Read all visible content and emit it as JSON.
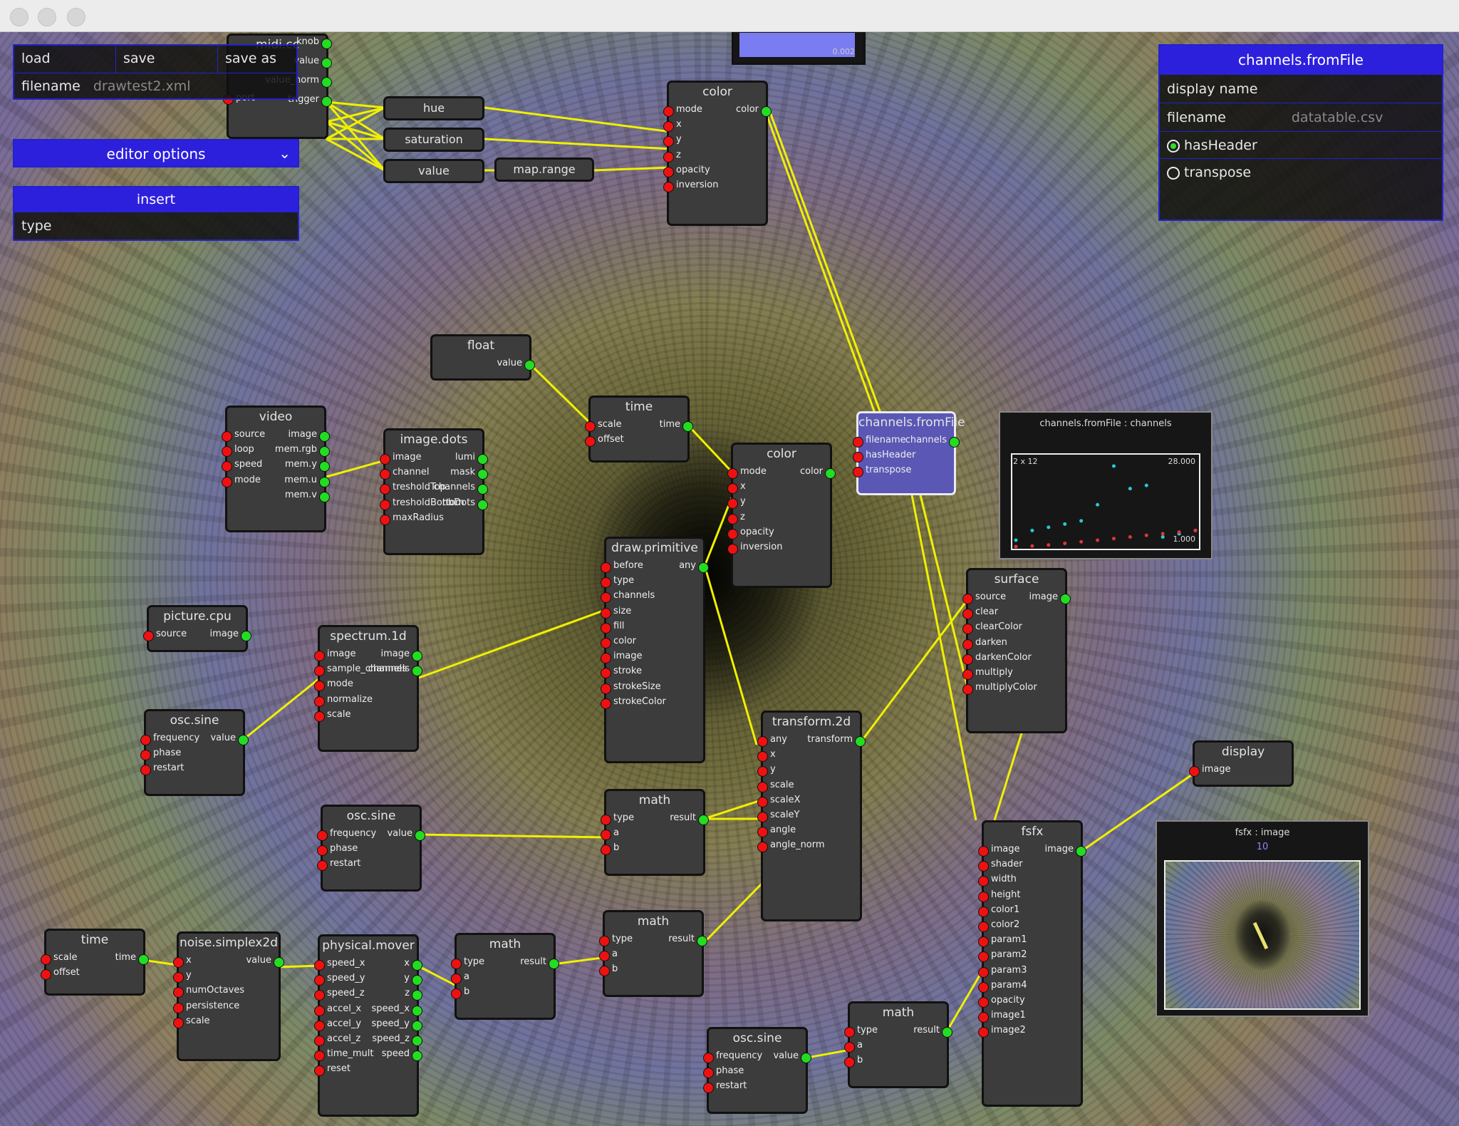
{
  "toolbar": {
    "load": "load",
    "save": "save",
    "save_as": "save as",
    "filename_label": "filename",
    "filename_value": "drawtest2.xml"
  },
  "editor_options": {
    "label": "editor options"
  },
  "insert": {
    "title": "insert",
    "type_label": "type"
  },
  "inspector": {
    "title": "channels.fromFile",
    "display_name_label": "display name",
    "filename_label": "filename",
    "filename_value": "datatable.csv",
    "has_header_label": "hasHeader",
    "has_header_checked": true,
    "transpose_label": "transpose",
    "transpose_checked": false
  },
  "top_preview": {
    "value": "0.002"
  },
  "midi": {
    "title": "midi.cc",
    "port_label": "port",
    "outputs": [
      "knob",
      "value",
      "value_norm",
      "trigger"
    ]
  },
  "hue": {
    "title": "hue"
  },
  "saturation": {
    "title": "saturation"
  },
  "value_node": {
    "title": "value"
  },
  "map_range": {
    "title": "map.range"
  },
  "color_top": {
    "title": "color",
    "inputs": [
      "mode",
      "x",
      "y",
      "z",
      "opacity",
      "inversion"
    ],
    "outputs": [
      "color"
    ]
  },
  "float_node": {
    "title": "float",
    "outputs": [
      "value"
    ]
  },
  "time_mid": {
    "title": "time",
    "inputs": [
      "scale",
      "offset"
    ],
    "outputs": [
      "time"
    ]
  },
  "color_mid": {
    "title": "color",
    "inputs": [
      "mode",
      "x",
      "y",
      "z",
      "opacity",
      "inversion"
    ],
    "outputs": [
      "color"
    ]
  },
  "channels_node": {
    "title": "channels.fromFile",
    "inputs": [
      "filename",
      "hasHeader",
      "transpose"
    ],
    "outputs": [
      "channels"
    ]
  },
  "channels_viz": {
    "title": "channels.fromFile : channels",
    "dims": "2 x 12",
    "max": "28.000",
    "min": "1.000",
    "chart_data": {
      "type": "scatter",
      "series": [
        {
          "color": "#29c8d6",
          "values": [
            3,
            6,
            7,
            8,
            9,
            14,
            26,
            19,
            20,
            4,
            5,
            6
          ]
        },
        {
          "color": "#e03535",
          "values": [
            1,
            1.2,
            1.5,
            2,
            2.5,
            3,
            3.5,
            4,
            4.5,
            5,
            5.5,
            6
          ]
        }
      ]
    }
  },
  "video": {
    "title": "video",
    "inputs": [
      "source",
      "loop",
      "speed",
      "mode"
    ],
    "outputs": [
      "image",
      "mem.rgb",
      "mem.y",
      "mem.u",
      "mem.v"
    ]
  },
  "image_dots": {
    "title": "image.dots",
    "inputs": [
      "image",
      "channel",
      "tresholdTop",
      "tresholdBottom",
      "maxRadius"
    ],
    "outputs": [
      "lumi",
      "mask",
      "channels",
      "nbDots"
    ]
  },
  "draw_primitive": {
    "title": "draw.primitive",
    "inputs": [
      "before",
      "type",
      "channels",
      "size",
      "fill",
      "color",
      "image",
      "stroke",
      "strokeSize",
      "strokeColor"
    ],
    "outputs": [
      "any"
    ]
  },
  "surface": {
    "title": "surface",
    "inputs": [
      "source",
      "clear",
      "clearColor",
      "darken",
      "darkenColor",
      "multiply",
      "multiplyColor"
    ],
    "outputs": [
      "image"
    ]
  },
  "picture_cpu": {
    "title": "picture.cpu",
    "inputs": [
      "source"
    ],
    "outputs": [
      "image"
    ]
  },
  "spectrum": {
    "title": "spectrum.1d",
    "inputs": [
      "image",
      "sample_channels",
      "mode",
      "normalize",
      "scale"
    ],
    "outputs": [
      "image",
      "channels"
    ]
  },
  "osc_sine_1": {
    "title": "osc.sine",
    "inputs": [
      "frequency",
      "phase",
      "restart"
    ],
    "outputs": [
      "value"
    ]
  },
  "transform": {
    "title": "transform.2d",
    "inputs": [
      "any",
      "x",
      "y",
      "scale",
      "scaleX",
      "scaleY",
      "angle",
      "angle_norm"
    ],
    "outputs": [
      "transform"
    ]
  },
  "display_node": {
    "title": "display",
    "inputs": [
      "image"
    ]
  },
  "osc_sine_2": {
    "title": "osc.sine",
    "inputs": [
      "frequency",
      "phase",
      "restart"
    ],
    "outputs": [
      "value"
    ]
  },
  "math_1": {
    "title": "math",
    "inputs": [
      "type",
      "a",
      "b"
    ],
    "outputs": [
      "result"
    ]
  },
  "fsfx": {
    "title": "fsfx",
    "inputs": [
      "image",
      "shader",
      "width",
      "height",
      "color1",
      "color2",
      "param1",
      "param2",
      "param3",
      "param4",
      "opacity",
      "image1",
      "image2"
    ],
    "outputs": [
      "image"
    ]
  },
  "fsfx_viz": {
    "title": "fsfx : image",
    "value": "10"
  },
  "time_bottom": {
    "title": "time",
    "inputs": [
      "scale",
      "offset"
    ],
    "outputs": [
      "time"
    ]
  },
  "noise": {
    "title": "noise.simplex2d",
    "inputs": [
      "x",
      "y",
      "numOctaves",
      "persistence",
      "scale"
    ],
    "outputs": [
      "value"
    ]
  },
  "mover": {
    "title": "physical.mover",
    "inputs": [
      "speed_x",
      "speed_y",
      "speed_z",
      "accel_x",
      "accel_y",
      "accel_z",
      "time_mult",
      "reset"
    ],
    "outputs": [
      "x",
      "y",
      "z",
      "speed_x",
      "speed_y",
      "speed_z",
      "speed"
    ]
  },
  "math_2": {
    "title": "math",
    "inputs": [
      "type",
      "a",
      "b"
    ],
    "outputs": [
      "result"
    ]
  },
  "math_3": {
    "title": "math",
    "inputs": [
      "type",
      "a",
      "b"
    ],
    "outputs": [
      "result"
    ]
  },
  "osc_sine_3": {
    "title": "osc.sine",
    "inputs": [
      "frequency",
      "phase",
      "restart"
    ],
    "outputs": [
      "value"
    ]
  },
  "math_4": {
    "title": "math",
    "inputs": [
      "type",
      "a",
      "b"
    ],
    "outputs": [
      "result"
    ]
  },
  "colors": {
    "accent": "#2d20dd",
    "wire": "#f0f000",
    "port_in": "#ee1111",
    "port_out": "#22dd22",
    "node_bg": "#3c3c3c"
  }
}
